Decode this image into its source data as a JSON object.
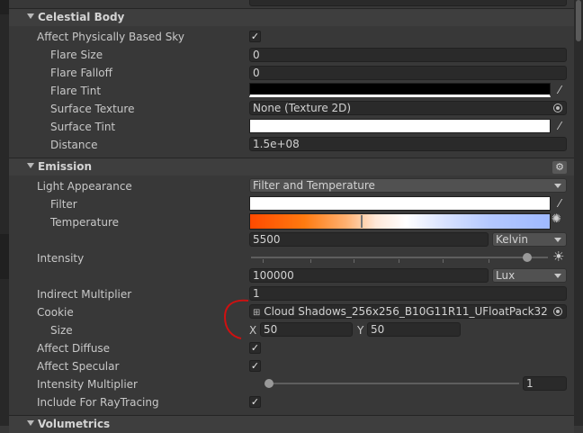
{
  "sections": {
    "celestial": {
      "title": "Celestial Body",
      "affect_sky_label": "Affect Physically Based Sky",
      "affect_sky_checked": true,
      "flare_size_label": "Flare Size",
      "flare_size_value": "0",
      "flare_falloff_label": "Flare Falloff",
      "flare_falloff_value": "0",
      "flare_tint_label": "Flare Tint",
      "surface_texture_label": "Surface Texture",
      "surface_texture_value": "None (Texture 2D)",
      "surface_tint_label": "Surface Tint",
      "distance_label": "Distance",
      "distance_value": "1.5e+08"
    },
    "emission": {
      "title": "Emission",
      "light_appearance_label": "Light Appearance",
      "light_appearance_value": "Filter and Temperature",
      "filter_label": "Filter",
      "temperature_label": "Temperature",
      "temperature_value": "5500",
      "temperature_unit": "Kelvin",
      "intensity_label": "Intensity",
      "intensity_value": "100000",
      "intensity_unit": "Lux",
      "intensity_slider_level": 0.93,
      "indirect_multiplier_label": "Indirect Multiplier",
      "indirect_multiplier_value": "1",
      "cookie_label": "Cookie",
      "cookie_value": "Cloud Shadows_256x256_B10G11R11_UFloatPack32",
      "size_label": "Size",
      "size_x_label": "X",
      "size_x_value": "50",
      "size_y_label": "Y",
      "size_y_value": "50",
      "affect_diffuse_label": "Affect Diffuse",
      "affect_diffuse_checked": true,
      "affect_specular_label": "Affect Specular",
      "affect_specular_checked": true,
      "intensity_multiplier_label": "Intensity Multiplier",
      "intensity_multiplier_value": "1",
      "intensity_multiplier_slider_level": 0.0,
      "raytracing_label": "Include For RayTracing",
      "raytracing_checked": true
    },
    "volumetrics": {
      "title": "Volumetrics"
    }
  },
  "icons": {
    "check": "✓",
    "eyedropper": "eyedropper-icon",
    "object_picker": "object-picker-icon",
    "gear": "gear-icon",
    "sun": "sun-icon"
  },
  "colors": {
    "flare_tint": "#000000",
    "surface_tint": "#ffffff",
    "filter": "#ffffff",
    "annotation": "#d01010"
  }
}
